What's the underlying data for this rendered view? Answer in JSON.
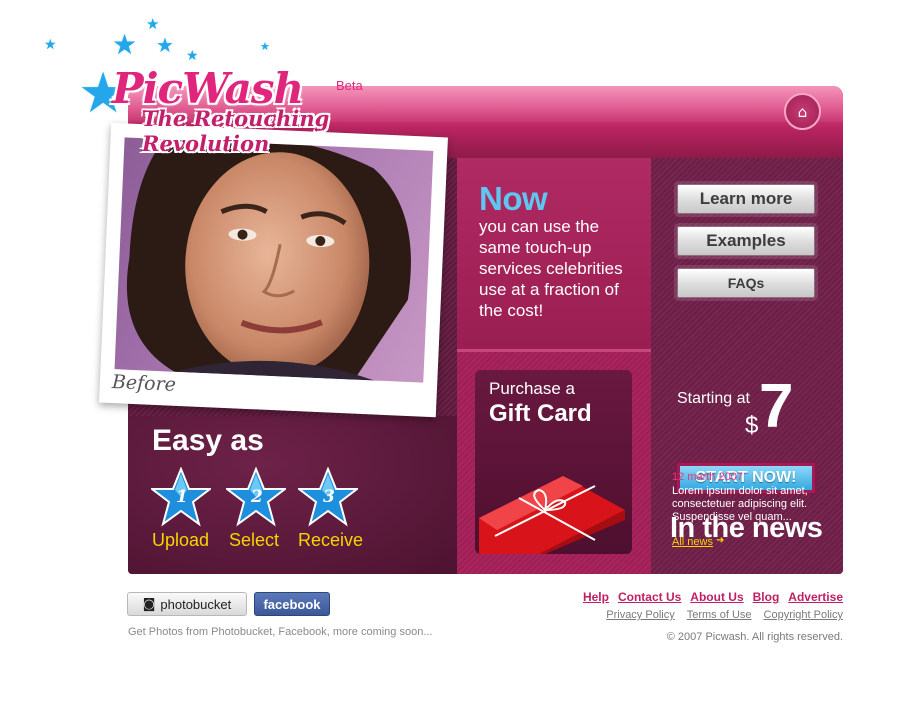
{
  "brand": {
    "name": "PicWash",
    "beta": "Beta",
    "tagline": "The Retouching Revolution"
  },
  "colors": {
    "brand_pink": "#e0267c",
    "accent_blue": "#5ec6ef",
    "step_yellow": "#f6d400"
  },
  "header": {
    "home_icon": "home-icon"
  },
  "photo": {
    "caption": "Before"
  },
  "promo": {
    "headline": "Now",
    "body": "you can use the same touch-up services celebrities use at a fraction of the cost!"
  },
  "gift": {
    "pre": "Purchase a",
    "main": "Gift Card"
  },
  "nav_buttons": [
    "Learn more",
    "Examples",
    "FAQs"
  ],
  "pricing": {
    "starting": "Starting at",
    "currency": "$",
    "amount": "7",
    "cta": "START NOW!"
  },
  "steps": {
    "title": "Easy as",
    "items": [
      {
        "number": "1",
        "label": "Upload"
      },
      {
        "number": "2",
        "label": "Select"
      },
      {
        "number": "3",
        "label": "Receive"
      }
    ]
  },
  "news": {
    "title": "In the news",
    "date": "12 marth 2007",
    "text": "Lorem ipsum dolor sit amet, consectetuer adipiscing elit. Suspendisse vel quam...",
    "all_link": "All news"
  },
  "footer": {
    "photobucket": "photobucket",
    "facebook": "facebook",
    "note": "Get Photos from Photobucket, Facebook, more coming soon...",
    "links": [
      "Help",
      "Contact Us",
      "About Us",
      "Blog",
      "Advertise"
    ],
    "sublinks": [
      "Privacy Policy",
      "Terms of Use",
      "Copyright Policy"
    ],
    "copyright": "© 2007 Picwash. All rights reserved."
  }
}
